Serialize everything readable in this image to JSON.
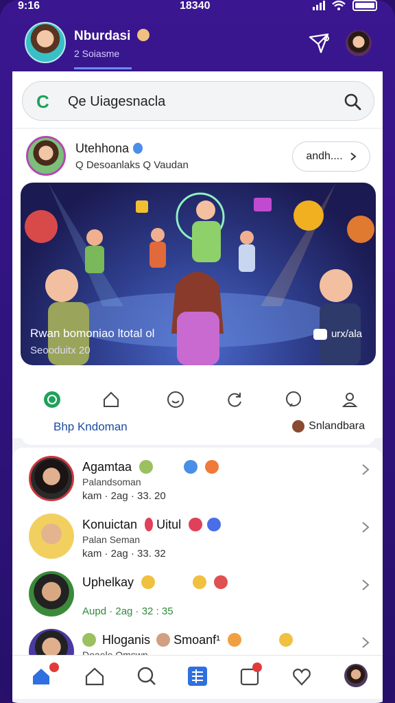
{
  "status": {
    "time": "9:16",
    "center": "18340"
  },
  "header": {
    "title": "Nburdasi",
    "subtitle": "2 Soiasme"
  },
  "search": {
    "logo": "C",
    "text": "Qe Uiagesnacla"
  },
  "profile": {
    "name": "Utehhona",
    "subtitle": "Q Desoanlaks Q Vaudan",
    "button_label": "andh...."
  },
  "banner": {
    "caption": "Rwan bomoniao ltotal ol",
    "sub": "Seooduitx 20",
    "chip": "urx/ala"
  },
  "tabs": {
    "left_label": "Bhp Kndoman",
    "right_label": "Snlandbara"
  },
  "list": [
    {
      "name": "Agamtaa",
      "sub": "Palandsoman",
      "meta": "kam  · 2ag · 33. 20"
    },
    {
      "name": "Konuictan",
      "name_suffix": "Uitul",
      "sub": "Palan Seman",
      "meta": "kam  · 2ag · 33. 32"
    },
    {
      "name": "Uphelkay",
      "sub": "",
      "meta": "Aupd  · 2ag · 32 : 35"
    },
    {
      "name": "Hloganis",
      "name_suffix": "Smoanf¹",
      "sub": "Doaele Omswn",
      "meta": ""
    }
  ],
  "colors": {
    "accent": "#3a1690",
    "link": "#1e4aa0",
    "badge": "#e23a3a"
  }
}
